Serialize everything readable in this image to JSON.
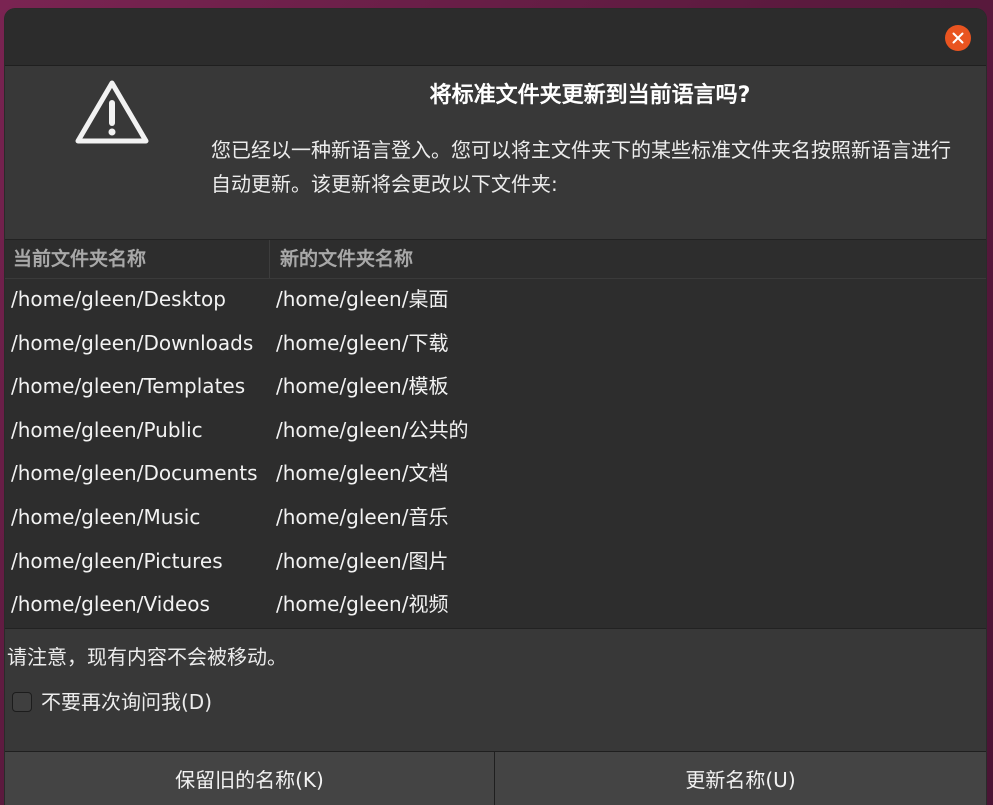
{
  "dialog": {
    "heading": "将标准文件夹更新到当前语言吗?",
    "description": "您已经以一种新语言登入。您可以将主文件夹下的某些标准文件夹名按照新语言进行自动更新。该更新将会更改以下文件夹:",
    "icons": {
      "warning": "warning-icon",
      "close": "close-icon"
    },
    "accent_color": "#e95420"
  },
  "table": {
    "columns": [
      "当前文件夹名称",
      "新的文件夹名称"
    ],
    "rows": [
      [
        "/home/gleen/Desktop",
        "/home/gleen/桌面"
      ],
      [
        "/home/gleen/Downloads",
        "/home/gleen/下载"
      ],
      [
        "/home/gleen/Templates",
        "/home/gleen/模板"
      ],
      [
        "/home/gleen/Public",
        "/home/gleen/公共的"
      ],
      [
        "/home/gleen/Documents",
        "/home/gleen/文档"
      ],
      [
        "/home/gleen/Music",
        "/home/gleen/音乐"
      ],
      [
        "/home/gleen/Pictures",
        "/home/gleen/图片"
      ],
      [
        "/home/gleen/Videos",
        "/home/gleen/视频"
      ]
    ]
  },
  "note": "请注意，现有内容不会被移动。",
  "checkbox": {
    "label": "不要再次询问我(D)",
    "checked": false
  },
  "buttons": {
    "keep": "保留旧的名称(K)",
    "update": "更新名称(U)"
  }
}
